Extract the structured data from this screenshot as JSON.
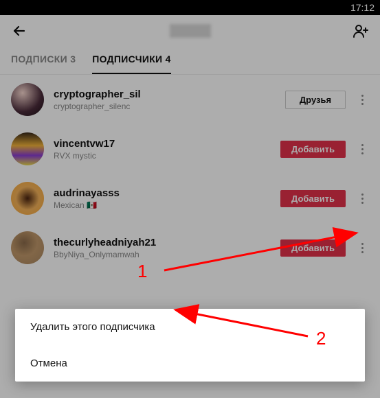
{
  "status": {
    "time": "17:12"
  },
  "tabs": {
    "subscriptions": {
      "label": "ПОДПИСКИ",
      "count": "3"
    },
    "followers": {
      "label": "ПОДПИСЧИКИ",
      "count": "4"
    }
  },
  "buttons": {
    "friends": "Друзья",
    "add": "Добавить"
  },
  "rows": [
    {
      "username": "cryptographer_sil",
      "display": "cryptographer_silenc",
      "type": "friends"
    },
    {
      "username": "vincentvw17",
      "display": "RVX mystic",
      "type": "add"
    },
    {
      "username": "audrinayasss",
      "display": "Mexican 🇲🇽",
      "type": "add"
    },
    {
      "username": "thecurlyheadniyah21",
      "display": "BbyNiya_Onlymamwah",
      "type": "add"
    }
  ],
  "sheet": {
    "remove": "Удалить этого подписчика",
    "cancel": "Отмена"
  },
  "annotations": {
    "one": "1",
    "two": "2"
  }
}
